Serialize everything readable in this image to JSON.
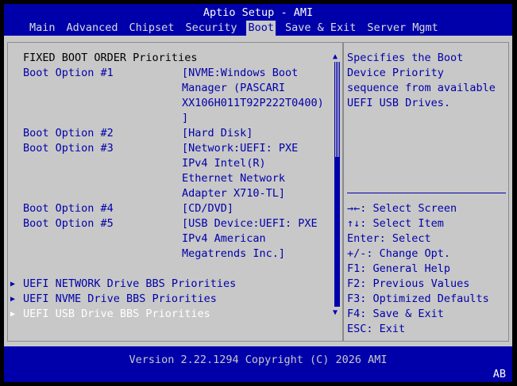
{
  "app_title": "Aptio Setup - AMI",
  "tabs": [
    "Main",
    "Advanced",
    "Chipset",
    "Security",
    "Boot",
    "Save & Exit",
    "Server Mgmt"
  ],
  "active_tab": "Boot",
  "section_heading": "FIXED BOOT ORDER Priorities",
  "boot_options": [
    {
      "label": "Boot Option #1",
      "value_lines": [
        "[NVME:Windows Boot",
        "Manager (PASCARI",
        "XX106H011T92P222T0400)",
        "]"
      ]
    },
    {
      "label": "Boot Option #2",
      "value_lines": [
        "[Hard Disk]"
      ]
    },
    {
      "label": "Boot Option #3",
      "value_lines": [
        "[Network:UEFI: PXE",
        "IPv4 Intel(R)",
        "Ethernet Network",
        "Adapter X710-TL]"
      ]
    },
    {
      "label": "Boot Option #4",
      "value_lines": [
        "[CD/DVD]"
      ]
    },
    {
      "label": "Boot Option #5",
      "value_lines": [
        "[USB Device:UEFI: PXE",
        "IPv4 American",
        "Megatrends Inc.]"
      ]
    }
  ],
  "submenus": [
    {
      "label": "UEFI NETWORK Drive BBS Priorities",
      "selected": false
    },
    {
      "label": "UEFI NVME Drive BBS Priorities",
      "selected": false
    },
    {
      "label": "UEFI USB Drive BBS Priorities",
      "selected": true
    }
  ],
  "help_text_lines": [
    "Specifies the Boot",
    "Device Priority",
    "sequence from available",
    "UEFI USB Drives."
  ],
  "key_help": [
    "→←: Select Screen",
    "↑↓: Select Item",
    "Enter: Select",
    "+/-: Change Opt.",
    "F1: General Help",
    "F2: Previous Values",
    "F3: Optimized Defaults",
    "F4: Save & Exit",
    "ESC: Exit"
  ],
  "version_text": "Version 2.22.1294 Copyright (C) 2026 AMI",
  "badge": "AB",
  "icons": {
    "submenu_arrow": "▶",
    "scroll_up": "▲",
    "scroll_down": "▼"
  },
  "colors": {
    "background": "#c8c8c8",
    "accent": "#0000aa",
    "selected_text": "#ffffff"
  }
}
